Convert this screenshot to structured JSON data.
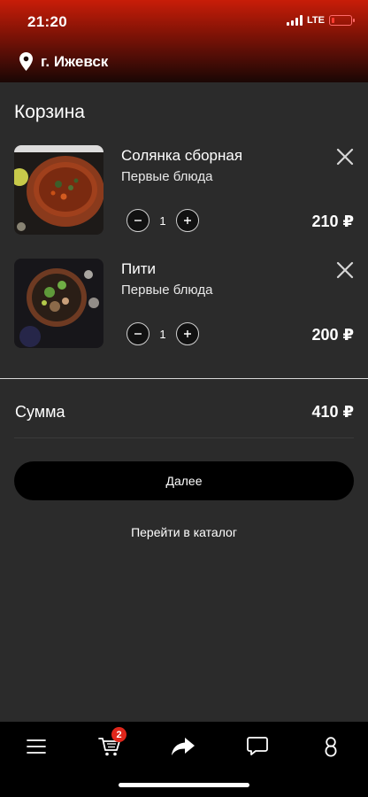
{
  "status_bar": {
    "time": "21:20",
    "network": "LTE",
    "icons": [
      "signal-icon",
      "battery-icon"
    ]
  },
  "header": {
    "city": "г. Ижевск",
    "icon": "location-pin-icon"
  },
  "cart": {
    "title": "Корзина",
    "items": [
      {
        "name": "Солянка сборная",
        "category": "Первые блюда",
        "quantity": "1",
        "price": "210 ₽",
        "image": "solyanka-soup-photo"
      },
      {
        "name": "Пити",
        "category": "Первые блюда",
        "quantity": "1",
        "price": "200 ₽",
        "image": "piti-soup-photo"
      }
    ],
    "summary_label": "Сумма",
    "summary_value": "410 ₽",
    "next_label": "Далее",
    "catalog_link": "Перейти в каталог"
  },
  "tabbar": {
    "tabs": [
      "menu-icon",
      "cart-icon",
      "share-icon",
      "chat-icon",
      "profile-icon"
    ],
    "cart_badge": "2"
  },
  "colors": {
    "background": "#2b2b2b",
    "header_top": "#c81d08",
    "badge": "#e0261b",
    "tabbar": "#000000"
  }
}
